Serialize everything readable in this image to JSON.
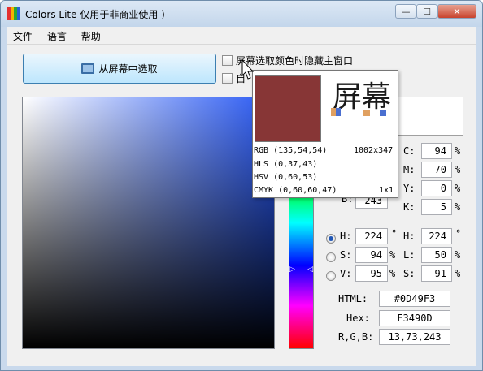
{
  "window": {
    "title": "Colors Lite 仅用于非商业使用 )",
    "min_glyph": "—",
    "max_glyph": "☐",
    "close_glyph": "✕",
    "icon_colors": [
      "#e43030",
      "#f5b400",
      "#2aa832",
      "#2463d6"
    ]
  },
  "menu": [
    "文件",
    "语言",
    "帮助"
  ],
  "pick_button": {
    "label": "从屏幕中选取",
    "icon": "monitor-icon"
  },
  "checkboxes": [
    {
      "label": "屏幕选取颜色时隐藏主窗口",
      "checked": false
    },
    {
      "label": "自",
      "checked": false
    }
  ],
  "picker": {
    "base_color": "#2858F3",
    "hue_level": 0.69
  },
  "popup": {
    "swatch_color": "#873636",
    "zoom_text": "屏幕",
    "rgb": "RGB (135,54,54)",
    "size": "1002x347",
    "hls": "HLS (0,37,43)",
    "hsv": "HSV (0,60,53)",
    "cmyk": "CMYK (0,60,60,47)",
    "scale": "1x1"
  },
  "rgb_partial": {
    "b_label": "B:",
    "b_value": "243"
  },
  "cmyk": [
    {
      "label": "C:",
      "value": "94",
      "unit": "%"
    },
    {
      "label": "M:",
      "value": "70",
      "unit": "%"
    },
    {
      "label": "Y:",
      "value": "0",
      "unit": "%"
    },
    {
      "label": "K:",
      "value": "5",
      "unit": "%"
    }
  ],
  "hsv": [
    {
      "label": "H:",
      "value": "224",
      "unit": "°",
      "selected": true
    },
    {
      "label": "S:",
      "value": "94",
      "unit": "%",
      "selected": false
    },
    {
      "label": "V:",
      "value": "95",
      "unit": "%",
      "selected": false
    }
  ],
  "hsl": [
    {
      "label": "H:",
      "value": "224",
      "unit": "°"
    },
    {
      "label": "L:",
      "value": "50",
      "unit": "%"
    },
    {
      "label": "S:",
      "value": "91",
      "unit": "%"
    }
  ],
  "codes": [
    {
      "label": "HTML:",
      "value": "#0D49F3"
    },
    {
      "label": "Hex:",
      "value": "F3490D"
    },
    {
      "label": "R,G,B:",
      "value": "13,73,243"
    }
  ]
}
